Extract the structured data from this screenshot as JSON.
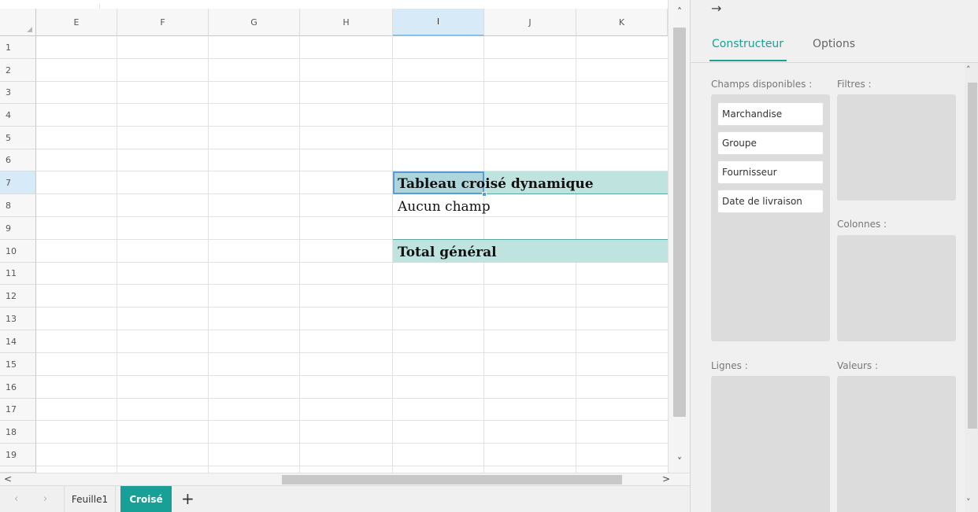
{
  "grid": {
    "columns": [
      "E",
      "F",
      "G",
      "H",
      "I",
      "J",
      "K"
    ],
    "selected_column": "I",
    "rows": [
      "1",
      "2",
      "3",
      "4",
      "5",
      "6",
      "7",
      "8",
      "9",
      "10",
      "11",
      "12",
      "13",
      "14",
      "15",
      "16",
      "17",
      "18",
      "19"
    ],
    "pivot": {
      "title": "Tableau croisé dynamique",
      "empty_label": "Aucun champ",
      "total_label": "Total général"
    }
  },
  "sheet_tabs": {
    "prev_icon": "‹",
    "next_icon": "›",
    "tabs": [
      {
        "label": "Feuille1",
        "active": false
      },
      {
        "label": "Croisé",
        "active": true
      }
    ],
    "add_icon": "+"
  },
  "panel": {
    "collapse_icon": "→",
    "tabs": [
      {
        "label": "Constructeur",
        "active": true
      },
      {
        "label": "Options",
        "active": false
      }
    ],
    "available_fields_label": "Champs disponibles :",
    "fields": [
      "Marchandise",
      "Groupe",
      "Fournisseur",
      "Date de livraison"
    ],
    "filters_label": "Filtres :",
    "columns_label": "Colonnes :",
    "rows_label": "Lignes :",
    "values_label": "Valeurs :"
  },
  "colors": {
    "accent": "#19a096",
    "pivot_band": "#bfe3df",
    "selection": "#5b9bd5"
  }
}
